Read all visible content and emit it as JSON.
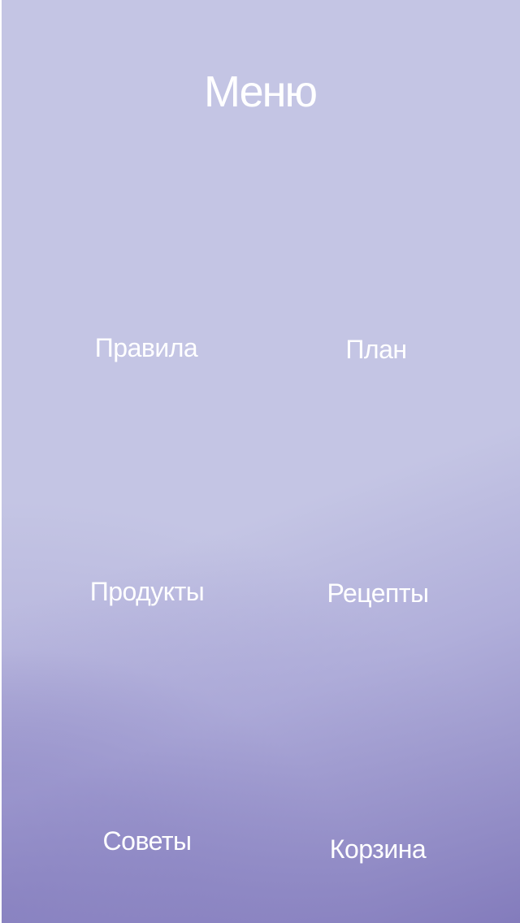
{
  "header": {
    "title": "Меню"
  },
  "menu": {
    "items": [
      {
        "id": "rules",
        "label": "Правила"
      },
      {
        "id": "plan",
        "label": "План"
      },
      {
        "id": "products",
        "label": "Продукты"
      },
      {
        "id": "recipes",
        "label": "Рецепты"
      },
      {
        "id": "tips",
        "label": "Советы"
      },
      {
        "id": "cart",
        "label": "Корзина"
      }
    ]
  },
  "colors": {
    "background_top": "#c4c5e4",
    "background_bottom_left": "#7c74b6",
    "text": "#ffffff"
  }
}
